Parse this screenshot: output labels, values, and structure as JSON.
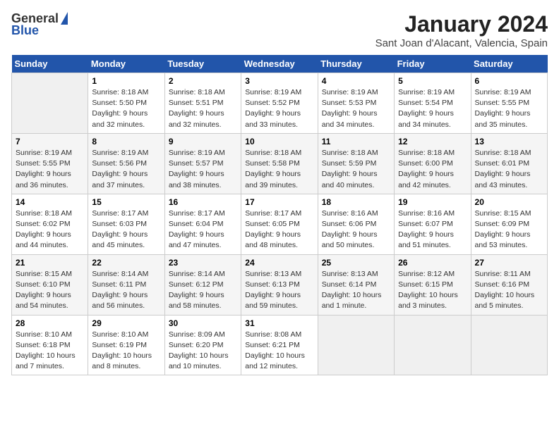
{
  "header": {
    "logo_general": "General",
    "logo_blue": "Blue",
    "title": "January 2024",
    "subtitle": "Sant Joan d'Alacant, Valencia, Spain"
  },
  "days_of_week": [
    "Sunday",
    "Monday",
    "Tuesday",
    "Wednesday",
    "Thursday",
    "Friday",
    "Saturday"
  ],
  "weeks": [
    [
      {
        "day": "",
        "sunrise": "",
        "sunset": "",
        "daylight": "",
        "empty": true
      },
      {
        "day": "1",
        "sunrise": "Sunrise: 8:18 AM",
        "sunset": "Sunset: 5:50 PM",
        "daylight": "Daylight: 9 hours and 32 minutes."
      },
      {
        "day": "2",
        "sunrise": "Sunrise: 8:18 AM",
        "sunset": "Sunset: 5:51 PM",
        "daylight": "Daylight: 9 hours and 32 minutes."
      },
      {
        "day": "3",
        "sunrise": "Sunrise: 8:19 AM",
        "sunset": "Sunset: 5:52 PM",
        "daylight": "Daylight: 9 hours and 33 minutes."
      },
      {
        "day": "4",
        "sunrise": "Sunrise: 8:19 AM",
        "sunset": "Sunset: 5:53 PM",
        "daylight": "Daylight: 9 hours and 34 minutes."
      },
      {
        "day": "5",
        "sunrise": "Sunrise: 8:19 AM",
        "sunset": "Sunset: 5:54 PM",
        "daylight": "Daylight: 9 hours and 34 minutes."
      },
      {
        "day": "6",
        "sunrise": "Sunrise: 8:19 AM",
        "sunset": "Sunset: 5:55 PM",
        "daylight": "Daylight: 9 hours and 35 minutes."
      }
    ],
    [
      {
        "day": "7",
        "sunrise": "Sunrise: 8:19 AM",
        "sunset": "Sunset: 5:55 PM",
        "daylight": "Daylight: 9 hours and 36 minutes."
      },
      {
        "day": "8",
        "sunrise": "Sunrise: 8:19 AM",
        "sunset": "Sunset: 5:56 PM",
        "daylight": "Daylight: 9 hours and 37 minutes."
      },
      {
        "day": "9",
        "sunrise": "Sunrise: 8:19 AM",
        "sunset": "Sunset: 5:57 PM",
        "daylight": "Daylight: 9 hours and 38 minutes."
      },
      {
        "day": "10",
        "sunrise": "Sunrise: 8:18 AM",
        "sunset": "Sunset: 5:58 PM",
        "daylight": "Daylight: 9 hours and 39 minutes."
      },
      {
        "day": "11",
        "sunrise": "Sunrise: 8:18 AM",
        "sunset": "Sunset: 5:59 PM",
        "daylight": "Daylight: 9 hours and 40 minutes."
      },
      {
        "day": "12",
        "sunrise": "Sunrise: 8:18 AM",
        "sunset": "Sunset: 6:00 PM",
        "daylight": "Daylight: 9 hours and 42 minutes."
      },
      {
        "day": "13",
        "sunrise": "Sunrise: 8:18 AM",
        "sunset": "Sunset: 6:01 PM",
        "daylight": "Daylight: 9 hours and 43 minutes."
      }
    ],
    [
      {
        "day": "14",
        "sunrise": "Sunrise: 8:18 AM",
        "sunset": "Sunset: 6:02 PM",
        "daylight": "Daylight: 9 hours and 44 minutes."
      },
      {
        "day": "15",
        "sunrise": "Sunrise: 8:17 AM",
        "sunset": "Sunset: 6:03 PM",
        "daylight": "Daylight: 9 hours and 45 minutes."
      },
      {
        "day": "16",
        "sunrise": "Sunrise: 8:17 AM",
        "sunset": "Sunset: 6:04 PM",
        "daylight": "Daylight: 9 hours and 47 minutes."
      },
      {
        "day": "17",
        "sunrise": "Sunrise: 8:17 AM",
        "sunset": "Sunset: 6:05 PM",
        "daylight": "Daylight: 9 hours and 48 minutes."
      },
      {
        "day": "18",
        "sunrise": "Sunrise: 8:16 AM",
        "sunset": "Sunset: 6:06 PM",
        "daylight": "Daylight: 9 hours and 50 minutes."
      },
      {
        "day": "19",
        "sunrise": "Sunrise: 8:16 AM",
        "sunset": "Sunset: 6:07 PM",
        "daylight": "Daylight: 9 hours and 51 minutes."
      },
      {
        "day": "20",
        "sunrise": "Sunrise: 8:15 AM",
        "sunset": "Sunset: 6:09 PM",
        "daylight": "Daylight: 9 hours and 53 minutes."
      }
    ],
    [
      {
        "day": "21",
        "sunrise": "Sunrise: 8:15 AM",
        "sunset": "Sunset: 6:10 PM",
        "daylight": "Daylight: 9 hours and 54 minutes."
      },
      {
        "day": "22",
        "sunrise": "Sunrise: 8:14 AM",
        "sunset": "Sunset: 6:11 PM",
        "daylight": "Daylight: 9 hours and 56 minutes."
      },
      {
        "day": "23",
        "sunrise": "Sunrise: 8:14 AM",
        "sunset": "Sunset: 6:12 PM",
        "daylight": "Daylight: 9 hours and 58 minutes."
      },
      {
        "day": "24",
        "sunrise": "Sunrise: 8:13 AM",
        "sunset": "Sunset: 6:13 PM",
        "daylight": "Daylight: 9 hours and 59 minutes."
      },
      {
        "day": "25",
        "sunrise": "Sunrise: 8:13 AM",
        "sunset": "Sunset: 6:14 PM",
        "daylight": "Daylight: 10 hours and 1 minute."
      },
      {
        "day": "26",
        "sunrise": "Sunrise: 8:12 AM",
        "sunset": "Sunset: 6:15 PM",
        "daylight": "Daylight: 10 hours and 3 minutes."
      },
      {
        "day": "27",
        "sunrise": "Sunrise: 8:11 AM",
        "sunset": "Sunset: 6:16 PM",
        "daylight": "Daylight: 10 hours and 5 minutes."
      }
    ],
    [
      {
        "day": "28",
        "sunrise": "Sunrise: 8:10 AM",
        "sunset": "Sunset: 6:18 PM",
        "daylight": "Daylight: 10 hours and 7 minutes."
      },
      {
        "day": "29",
        "sunrise": "Sunrise: 8:10 AM",
        "sunset": "Sunset: 6:19 PM",
        "daylight": "Daylight: 10 hours and 8 minutes."
      },
      {
        "day": "30",
        "sunrise": "Sunrise: 8:09 AM",
        "sunset": "Sunset: 6:20 PM",
        "daylight": "Daylight: 10 hours and 10 minutes."
      },
      {
        "day": "31",
        "sunrise": "Sunrise: 8:08 AM",
        "sunset": "Sunset: 6:21 PM",
        "daylight": "Daylight: 10 hours and 12 minutes."
      },
      {
        "day": "",
        "sunrise": "",
        "sunset": "",
        "daylight": "",
        "empty": true
      },
      {
        "day": "",
        "sunrise": "",
        "sunset": "",
        "daylight": "",
        "empty": true
      },
      {
        "day": "",
        "sunrise": "",
        "sunset": "",
        "daylight": "",
        "empty": true
      }
    ]
  ]
}
